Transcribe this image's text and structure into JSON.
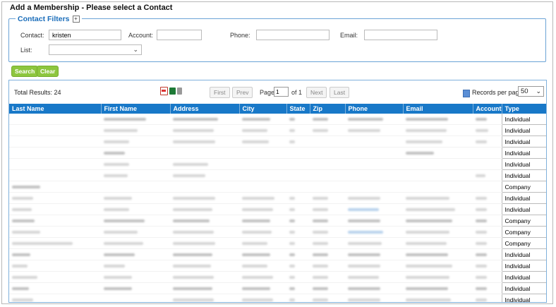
{
  "page": {
    "title": "Add a Membership - Please select a Contact"
  },
  "filters": {
    "legend": "Contact Filters",
    "expand_glyph": "+",
    "contact_label": "Contact:",
    "contact_value": "kristen",
    "account_label": "Account:",
    "account_value": "",
    "phone_label": "Phone:",
    "phone_value": "",
    "email_label": "Email:",
    "email_value": "",
    "list_label": "List:",
    "list_value": ""
  },
  "actions": {
    "search_label": "Search",
    "clear_label": "Clear"
  },
  "results": {
    "total_text": "Total Results: 24",
    "first_label": "First",
    "prev_label": "Prev",
    "page_label": "Page",
    "page_value": "1",
    "of_text": "of 1",
    "next_label": "Next",
    "last_label": "Last",
    "records_per_page_label": "Records per page:",
    "records_per_page_value": "50",
    "export_icons": [
      "pdf-icon",
      "excel-icon",
      "print-icon"
    ]
  },
  "table": {
    "columns": [
      "Last Name",
      "First Name",
      "Address",
      "City",
      "State",
      "Zip",
      "Phone",
      "Email",
      "Account",
      "Type"
    ],
    "types": [
      "Individual",
      "Individual",
      "Individual",
      "Individual",
      "Individual",
      "Individual",
      "Company",
      "Individual",
      "Individual",
      "Company",
      "Company",
      "Company",
      "Individual",
      "Individual",
      "Individual",
      "Individual",
      "Individual",
      "Individual"
    ]
  },
  "colors": {
    "header_blue": "#1878c8",
    "legend_blue": "#1a6dba",
    "button_green": "#8dc63f"
  }
}
